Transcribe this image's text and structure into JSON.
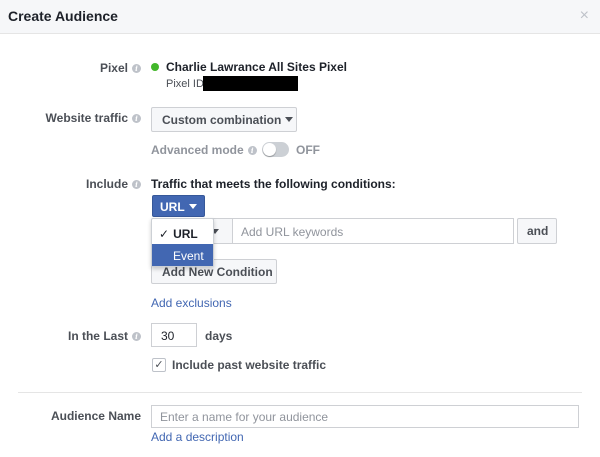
{
  "header": {
    "title": "Create Audience",
    "close_glyph": "×"
  },
  "labels": {
    "pixel": "Pixel",
    "website_traffic": "Website traffic",
    "include": "Include",
    "in_the_last": "In the Last",
    "audience_name": "Audience Name"
  },
  "pixel": {
    "name": "Charlie Lawrance All Sites Pixel",
    "id_label": "Pixel ID",
    "status_color": "#42b72a"
  },
  "website_traffic": {
    "selected": "Custom combination"
  },
  "advanced_mode": {
    "label": "Advanced mode",
    "state": "OFF"
  },
  "include": {
    "conditions_heading": "Traffic that meets the following conditions:",
    "type_button": "URL",
    "dropdown_options": [
      "URL",
      "Event"
    ],
    "checked_option": "✓",
    "url_placeholder": "Add URL keywords",
    "and_button": "and",
    "add_condition_button": "Add New Condition",
    "add_exclusions_link": "Add exclusions"
  },
  "in_the_last": {
    "value": "30",
    "unit": "days",
    "include_past_label": "Include past website traffic",
    "include_past_checked": "✓"
  },
  "audience": {
    "name_placeholder": "Enter a name for your audience",
    "add_description_link": "Add a description"
  },
  "colors": {
    "accent": "#4267b2",
    "link": "#4267b2"
  },
  "info_icon_glyph": "i"
}
